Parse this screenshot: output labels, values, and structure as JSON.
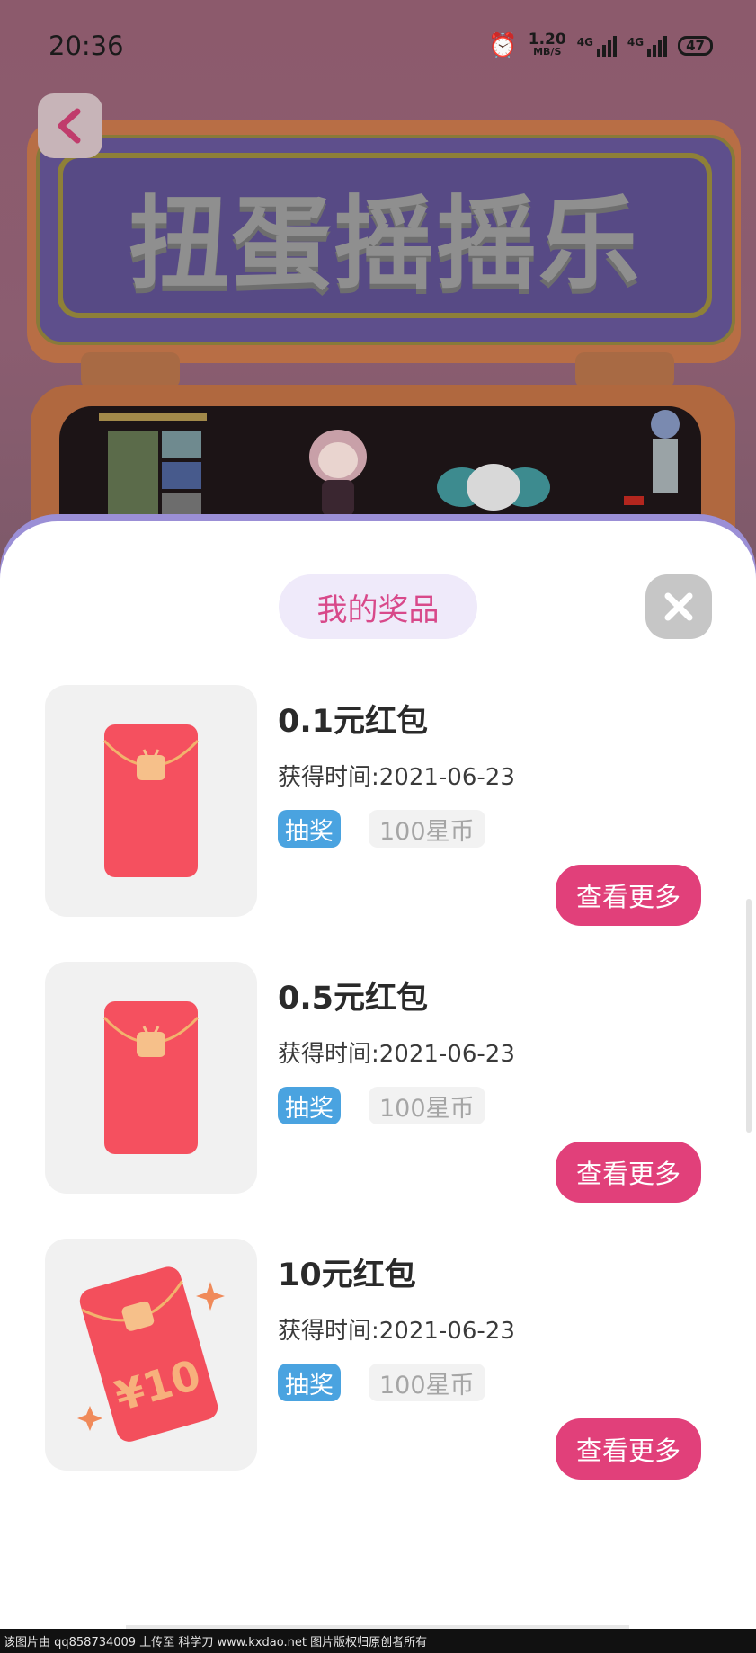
{
  "status_bar": {
    "time": "20:36",
    "speed_value": "1.20",
    "speed_unit": "MB/S",
    "net1_label": "4G",
    "net2_label": "4G",
    "battery": "47"
  },
  "banner": {
    "title": "扭蛋摇摇乐"
  },
  "sheet": {
    "title": "我的奖品"
  },
  "prizes": [
    {
      "title": "0.1元红包",
      "time_label": "获得时间:2021-06-23",
      "type_tag": "抽奖",
      "cost_tag": "100星币",
      "button_label": "查看更多"
    },
    {
      "title": "0.5元红包",
      "time_label": "获得时间:2021-06-23",
      "type_tag": "抽奖",
      "cost_tag": "100星币",
      "button_label": "查看更多"
    },
    {
      "title": "10元红包",
      "time_label": "获得时间:2021-06-23",
      "type_tag": "抽奖",
      "cost_tag": "100星币",
      "button_label": "查看更多"
    }
  ],
  "red_packet_amount_text": "¥10",
  "footer": {
    "watermark": "该图片由 qq858734009 上传至 科学刀 www.kxdao.net 图片版权归原创者所有"
  },
  "colors": {
    "accent": "#e1407a",
    "title_text": "#d8498a",
    "tag_blue": "#4aa3e0",
    "sheet_edge": "#9b8fd6"
  }
}
